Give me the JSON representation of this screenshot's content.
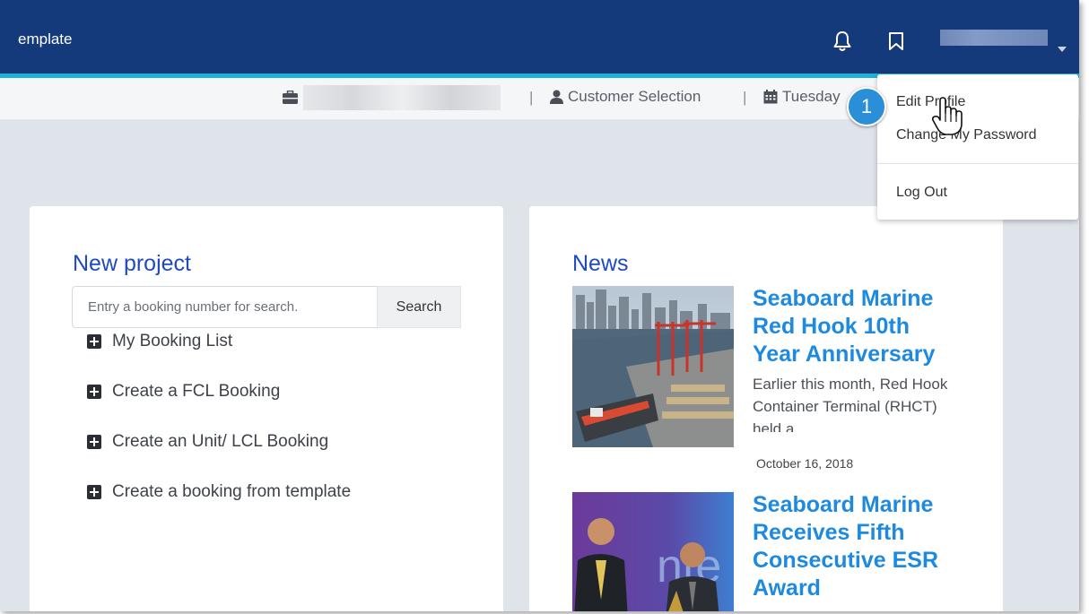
{
  "header": {
    "title": "emplate",
    "notifications_icon": "bell-icon",
    "bookmarks_icon": "bookmark-icon",
    "user_caret_icon": "caret-down-icon"
  },
  "infobar": {
    "separator": "|",
    "customer_selection": "Customer Selection",
    "date": "Tuesday"
  },
  "new_project": {
    "title": "New project",
    "search_placeholder": "Entry a booking number for search.",
    "search_button": "Search",
    "actions": [
      "My Booking List",
      "Create a FCL Booking",
      "Create an Unit/ LCL Booking",
      "Create a booking from template"
    ]
  },
  "news": {
    "title": "News",
    "items": [
      {
        "title": "Seaboard Marine Red Hook 10th Year Anniversary",
        "excerpt": "Earlier this month, Red Hook Container Terminal (RHCT) held a",
        "date": "October 16, 2018"
      },
      {
        "title": "Seaboard Marine Receives Fifth Consecutive ESR Award",
        "excerpt": "",
        "date": ""
      }
    ]
  },
  "user_menu": {
    "items": [
      "Edit Profile",
      "Change My Password",
      "Log Out"
    ]
  },
  "annotation": {
    "step_number": "1"
  },
  "colors": {
    "header_bg": "#153a7c",
    "accent": "#1fb1d9",
    "link_blue": "#1d8ae0",
    "title_blue": "#1f4ac0"
  }
}
